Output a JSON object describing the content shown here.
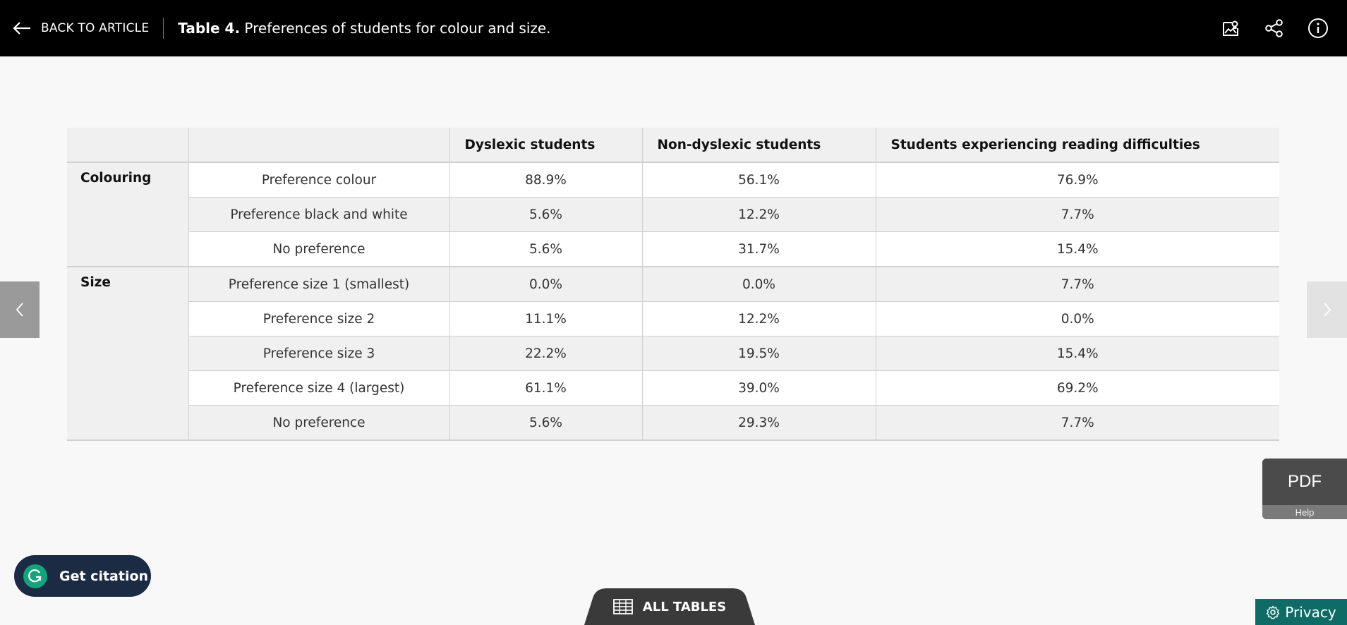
{
  "header": {
    "back_label": "BACK TO ARTICLE",
    "title_bold": "Table 4.",
    "title_rest": " Preferences of students for colour and size."
  },
  "icons": {
    "back": "arrow-left-icon",
    "save": "save-image-icon",
    "share": "share-icon",
    "info": "info-icon",
    "prev": "chevron-left-icon",
    "next": "chevron-right-icon",
    "grammarly": "grammarly-icon",
    "all_tables": "table-grid-icon",
    "privacy": "gear-icon"
  },
  "table": {
    "headers": [
      "",
      "",
      "Dyslexic students",
      "Non-dyslexic students",
      "Students experiencing reading difficulties"
    ],
    "groups": [
      {
        "label": "Colouring",
        "rows": [
          {
            "label": "Preference colour",
            "values": [
              "88.9%",
              "56.1%",
              "76.9%"
            ]
          },
          {
            "label": "Preference black and white",
            "values": [
              "5.6%",
              "12.2%",
              "7.7%"
            ]
          },
          {
            "label": "No preference",
            "values": [
              "5.6%",
              "31.7%",
              "15.4%"
            ]
          }
        ]
      },
      {
        "label": "Size",
        "rows": [
          {
            "label": "Preference size 1 (smallest)",
            "values": [
              "0.0%",
              "0.0%",
              "7.7%"
            ]
          },
          {
            "label": "Preference size 2",
            "values": [
              "11.1%",
              "12.2%",
              "0.0%"
            ]
          },
          {
            "label": "Preference size 3",
            "values": [
              "22.2%",
              "19.5%",
              "15.4%"
            ]
          },
          {
            "label": "Preference size 4 (largest)",
            "values": [
              "61.1%",
              "39.0%",
              "69.2%"
            ]
          },
          {
            "label": "No preference",
            "values": [
              "5.6%",
              "29.3%",
              "7.7%"
            ]
          }
        ]
      }
    ]
  },
  "widgets": {
    "pdf_label": "PDF",
    "help_label": "Help",
    "citation_label": "Get citation",
    "all_tables_label": "ALL TABLES",
    "privacy_label": "Privacy"
  },
  "colors": {
    "topbar": "#000000",
    "citation_bg": "#1c2b44",
    "grammarly_green": "#15a37b",
    "privacy_bg": "#0f6b66",
    "tab_bg": "#3a3a3a"
  }
}
